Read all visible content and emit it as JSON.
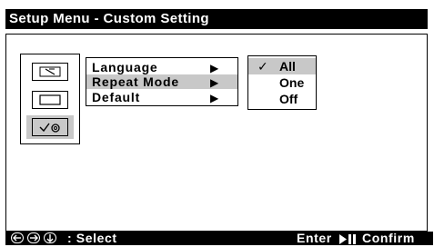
{
  "window": {
    "title": "Setup Menu - Custom Setting"
  },
  "categories": [
    {
      "icon": "language-screen-icon"
    },
    {
      "icon": "display-screen-icon"
    },
    {
      "icon": "custom-setting-icon"
    }
  ],
  "menu": {
    "items": [
      {
        "label": "Language",
        "arrow": "▶",
        "selected": false
      },
      {
        "label": "Repeat Mode",
        "arrow": "▶",
        "selected": true
      },
      {
        "label": "Default",
        "arrow": "▶",
        "selected": false
      }
    ]
  },
  "submenu": {
    "items": [
      {
        "label": "All",
        "check": "✓",
        "selected": true
      },
      {
        "label": "One",
        "check": "",
        "selected": false
      },
      {
        "label": "Off",
        "check": "",
        "selected": false
      }
    ]
  },
  "footer": {
    "nav_keys": [
      "left-arrow-key-icon",
      "right-arrow-key-icon",
      "down-arrow-key-icon"
    ],
    "select_text": ": Select",
    "enter_text": "Enter",
    "confirm_text": "Confirm"
  },
  "colors": {
    "background": "#ffffff",
    "bar": "#000000",
    "highlight": "#c8c8c8"
  }
}
